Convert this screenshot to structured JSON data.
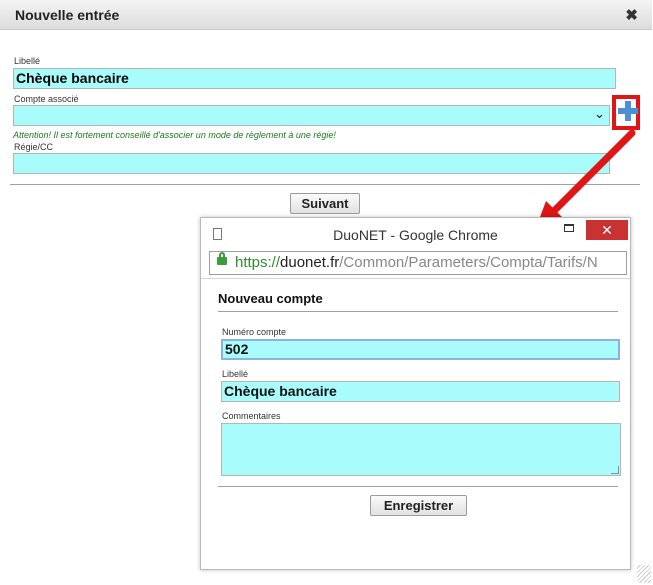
{
  "dialog": {
    "title": "Nouvelle entrée",
    "close_glyph": "✖",
    "libelle_label": "Libellé",
    "libelle_value": "Chèque bancaire",
    "compte_label": "Compte associé",
    "compte_value": "",
    "warning": "Attention! Il est fortement conseillé d'associer un mode de règlement à une régie!",
    "regie_label": "Régie/CC",
    "regie_value": "",
    "next_button": "Suivant",
    "add_icon": "plus-icon",
    "highlight_color": "#e01515",
    "field_color": "#a9fcfc"
  },
  "popup": {
    "window_title": "DuoNET - Google Chrome",
    "close_glyph": "✕",
    "url_scheme": "https://",
    "url_host": "duonet.fr",
    "url_path": "/Common/Parameters/Compta/Tarifs/N",
    "header": "Nouveau compte",
    "numero_label": "Numéro compte",
    "numero_value": "502",
    "libelle_label": "Libellé",
    "libelle_value": "Chèque bancaire",
    "commentaires_label": "Commentaires",
    "commentaires_value": "",
    "save_button": "Enregistrer",
    "titlebar_close_color": "#c93232",
    "lock_color": "#3c9c3c"
  }
}
